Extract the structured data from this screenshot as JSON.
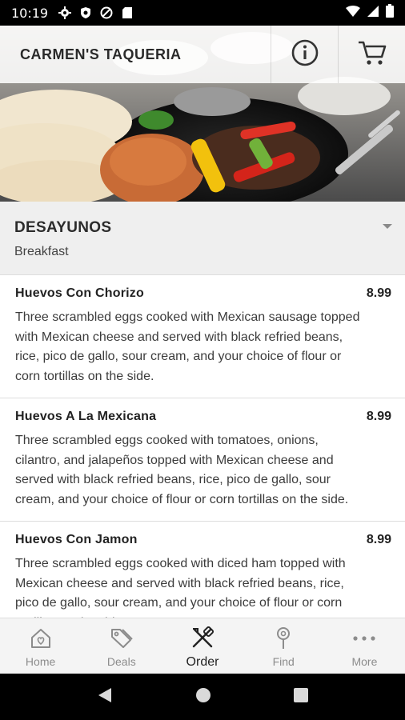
{
  "status": {
    "time": "10:19"
  },
  "header": {
    "brand": "CARMEN'S TAQUERIA"
  },
  "category": {
    "title": "DESAYUNOS",
    "subtitle": "Breakfast"
  },
  "menu": [
    {
      "name": "Huevos Con Chorizo",
      "price": "8.99",
      "description": "Three scrambled eggs cooked with Mexican sausage topped with Mexican cheese and served with black refried beans, rice, pico de gallo, sour cream, and your choice of flour or corn tortillas on the side."
    },
    {
      "name": "Huevos A La Mexicana",
      "price": "8.99",
      "description": "Three scrambled eggs cooked with tomatoes, onions, cilantro, and jalapeños topped with Mexican cheese and served with black refried beans, rice, pico de gallo, sour cream, and your choice of flour or corn tortillas on the side."
    },
    {
      "name": "Huevos Con Jamon",
      "price": "8.99",
      "description": "Three scrambled eggs cooked with diced ham topped with Mexican cheese and served with black refried beans, rice, pico de gallo, sour cream, and your choice of flour or corn tortillas on the side."
    }
  ],
  "nav": {
    "home": "Home",
    "deals": "Deals",
    "order": "Order",
    "find": "Find",
    "more": "More"
  },
  "colors": {
    "statusbar": "#000000",
    "category_bg": "#efefef",
    "nav_bg": "#f4f4f4",
    "inactive": "#8c8c8c",
    "active": "#222222"
  }
}
